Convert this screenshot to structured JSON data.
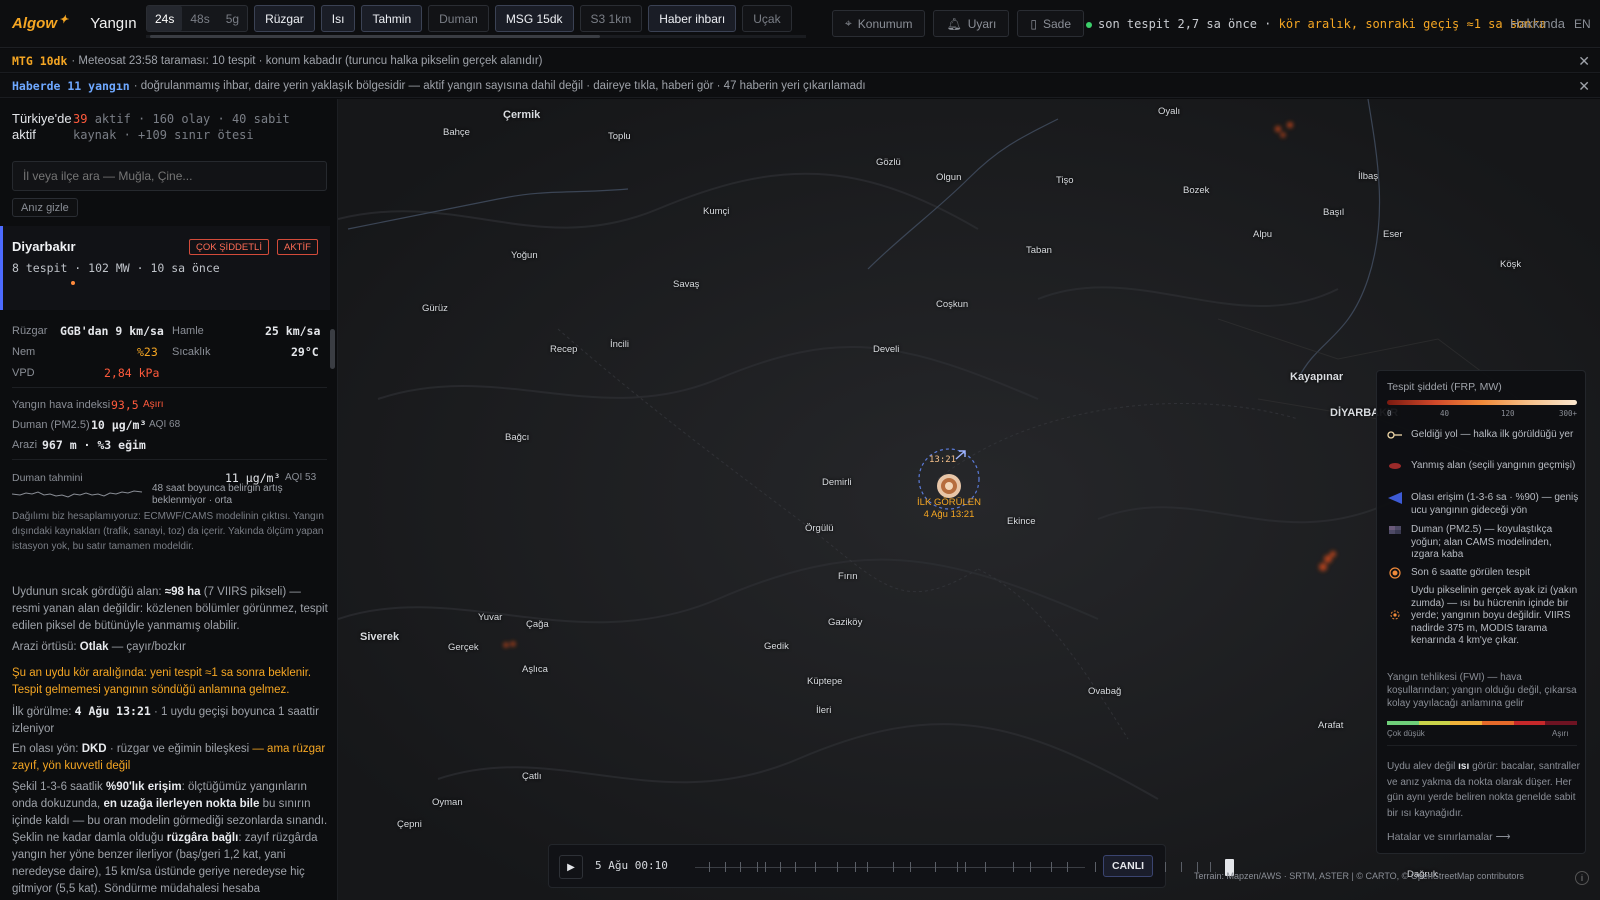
{
  "header": {
    "logo": "Algow",
    "title": "Yangın",
    "range_options": [
      "24s",
      "48s",
      "5g"
    ],
    "range_selected": "24s",
    "layers": [
      {
        "label": "Rüzgar",
        "on": true
      },
      {
        "label": "Isı",
        "on": true
      },
      {
        "label": "Tahmin",
        "on": true
      },
      {
        "label": "Duman",
        "on": false
      },
      {
        "label": "MSG 15dk",
        "on": true
      },
      {
        "label": "S3 1km",
        "on": false
      },
      {
        "label": "Haber ihbarı",
        "on": true
      },
      {
        "label": "Uçak",
        "on": false
      }
    ],
    "location_btn": "Konumum",
    "alert_btn": "Uyarı",
    "simple_btn": "Sade",
    "status_prefix": "son tespit 2,7 sa önce ·",
    "status_warn": "kör aralık, sonraki geçiş ≈1 sa sonra",
    "about": "Hakkında",
    "lang": "EN"
  },
  "banners": {
    "b1_tag": "MTG 10dk",
    "b1_text": "· Meteosat 23:58 taraması: 10 tespit · konum kabadır (turuncu halka pikselin gerçek alanıdır)",
    "b2_tag": "Haberde 11 yangın",
    "b2_text": "· doğrulanmamış ihbar, daire yerin yaklaşık bölgesidir — aktif yangın sayısına dahil değil · daireye tıkla, haberi gör · 47 haberin yeri çıkarılamadı"
  },
  "sidebar": {
    "country_label": "Türkiye'de aktif",
    "active_count": "39",
    "stats_rest": "aktif · 160 olay · 40 sabit kaynak · +109 sınır ötesi",
    "search_placeholder": "İl veya ilçe ara — Muğla, Çine...",
    "hide_btn": "Anız gizle",
    "fire": {
      "name": "Diyarbakır",
      "badge_severity": "ÇOK ŞİDDETLİ",
      "badge_status": "AKTİF",
      "meta": "8 tespit · 102 MW · 10 sa önce"
    },
    "weather": {
      "wind_label": "Rüzgar",
      "wind_value": "GGB'dan 9 km/sa",
      "gust_label": "Hamle",
      "gust_value": "25 km/sa",
      "humidity_label": "Nem",
      "humidity_value": "%23",
      "temp_label": "Sıcaklık",
      "temp_value": "29°C",
      "vpd_label": "VPD",
      "vpd_value": "2,84 kPa"
    },
    "indices": {
      "fwi_label": "Yangın hava indeksi",
      "fwi_value": "93,5",
      "fwi_level": "Aşırı",
      "smoke_label": "Duman (PM2.5)",
      "smoke_value": "10 µg/m³",
      "smoke_aqi": "AQI 68",
      "terrain_label": "Arazi",
      "terrain_value": "967 m · %3 eğim"
    },
    "forecast": {
      "label": "Duman tahmini",
      "value": "11 µg/m³",
      "aqi": "AQI 53",
      "trend": "48 saat boyunca belirgin artış beklenmiyor · orta",
      "note": "Dağılımı biz hesaplamıyoruz: ECMWF/CAMS modelinin çıktısı. Yangın dışındaki kaynakları (trafik, sanayi, toz) da içerir. Yakında ölçüm yapan istasyon yok, bu satır tamamen modeldir."
    },
    "area_pre": "Uydunun sıcak gördüğü alan:",
    "area_val": "≈98 ha",
    "area_post": "(7 VIIRS pikseli) — resmi yanan alan değildir: közlenen bölümler görünmez, tespit edilen piksel de bütünüyle yanmamış olabilir.",
    "landcover_pre": "Arazi örtüsü:",
    "landcover_val": "Otlak",
    "landcover_post": "— çayır/bozkır",
    "blind_warning": "Şu an uydu kör aralığında: yeni tespit ≈1 sa sonra beklenir. Tespit gelmemesi yangının söndüğü anlamına gelmez.",
    "first_pre": "İlk görülme:",
    "first_val": "4 Ağu 13:21",
    "first_post": "· 1 uydu geçişi boyunca 1 saattir izleniyor",
    "dir_pre": "En olası yön:",
    "dir_val": "DKD",
    "dir_mid": "· rüzgar ve eğimin bileşkesi",
    "dir_warn": "— ama rüzgar zayıf, yön kuvvetli değil",
    "shape_p1": "Şekil 1-3-6 saatlik",
    "shape_b1": "%90'lık erişim",
    "shape_p2": ": ölçtüğümüz yangınların onda dokuzunda,",
    "shape_b2": "en uzağa ilerleyen nokta bile",
    "shape_p3": "bu sınırın içinde kaldı — bu oran modelin görmediği sezonlarda sınandı. Şeklin ne kadar damla olduğu",
    "shape_b3": "rüzgâra bağlı",
    "shape_p4": ": zayıf rüzgârda yangın her yöne benzer ilerliyor (baş/geri 1,2 kat, yani neredeyse daire), 15 km/sa üstünde geriye neredeyse hiç gitmiyor (5,5 kat). Söndürme müdahalesi hesaba"
  },
  "map": {
    "places": [
      {
        "name": "Çermik",
        "big": true
      },
      {
        "name": "Bahçe"
      },
      {
        "name": "Toplu"
      },
      {
        "name": "Gözlü"
      },
      {
        "name": "Olgun"
      },
      {
        "name": "Tişo"
      },
      {
        "name": "Oyalı"
      },
      {
        "name": "Kumçi"
      },
      {
        "name": "Bozek"
      },
      {
        "name": "İlbaş"
      },
      {
        "name": "Başıl"
      },
      {
        "name": "Alpu"
      },
      {
        "name": "Eser"
      },
      {
        "name": "Köşk"
      },
      {
        "name": "Yoğun"
      },
      {
        "name": "Taban"
      },
      {
        "name": "Savaş"
      },
      {
        "name": "Gürüz"
      },
      {
        "name": "Coşkun"
      },
      {
        "name": "Recep"
      },
      {
        "name": "İncili"
      },
      {
        "name": "Develi"
      },
      {
        "name": "Kayapınar",
        "big": true
      },
      {
        "name": "DİYARBAKIR",
        "big": true
      },
      {
        "name": "Bağcı"
      },
      {
        "name": "Demirli"
      },
      {
        "name": "Örgülü"
      },
      {
        "name": "Ekince"
      },
      {
        "name": "Fırın"
      },
      {
        "name": "Siverek",
        "big": true
      },
      {
        "name": "Yuvar"
      },
      {
        "name": "Çağa"
      },
      {
        "name": "Gerçek"
      },
      {
        "name": "Gaziköy"
      },
      {
        "name": "Gedik"
      },
      {
        "name": "Aşlıca"
      },
      {
        "name": "Küptepe"
      },
      {
        "name": "İleri"
      },
      {
        "name": "Ovabağ"
      },
      {
        "name": "Arafat"
      },
      {
        "name": "Çatlı"
      },
      {
        "name": "Oyman"
      },
      {
        "name": "Çepni"
      },
      {
        "name": "Dağruk"
      }
    ],
    "marker_time": "13:21",
    "marker_label1": "İLK GÖRÜLEN",
    "marker_label2": "4 Ağu 13:21"
  },
  "timeline": {
    "time": "5 Ağu 00:10",
    "live": "CANLI"
  },
  "legend": {
    "title": "Tespit şiddeti (FRP, MW)",
    "frp_ticks": [
      "0",
      "40",
      "120",
      "300+"
    ],
    "items": [
      "Geldiği yol — halka ilk görüldüğü yer",
      "Yanmış alan (seçili yangının geçmişi)",
      "Olası erişim (1-3-6 sa · %90) — geniş ucu yangının gideceği yön",
      "Duman (PM2.5) — koyulaştıkça yoğun; alan CAMS modelinden, ızgara kaba",
      "Son 6 saatte görülen tespit",
      "Uydu pikselinin gerçek ayak izi (yakın zumda) — ısı bu hücrenin içinde bir yerde; yangının boyu değildir. VIIRS nadirde 375 m, MODIS tarama kenarında 4 km'ye çıkar."
    ],
    "fwi_title": "Yangın tehlikesi (FWI) — hava koşullarından; yangın olduğu değil, çıkarsa kolay yayılacağı anlamına gelir",
    "fwi_low": "Çok düşük",
    "fwi_high": "Aşırı",
    "fwi_colors": [
      "#6fcf7a",
      "#c9d34a",
      "#f0b23a",
      "#e56a2a",
      "#c6282a",
      "#6e1322"
    ],
    "note_pre": "Uydu alev değil",
    "note_bold": "ısı",
    "note_post": "görür: bacalar, santraller ve anız yakma da nokta olarak düşer. Her gün aynı yerde beliren nokta genelde sabit bir ısı kaynağıdır.",
    "link": "Hatalar ve sınırlamalar ⟶"
  },
  "attribution": "Terrain: Mapzen/AWS · SRTM, ASTER | © CARTO, © OpenStreetMap contributors",
  "colors": {
    "accent": "#f5a623",
    "danger": "#ff5a3c",
    "blue": "#4d6bff",
    "live": "#3ccf6a"
  }
}
